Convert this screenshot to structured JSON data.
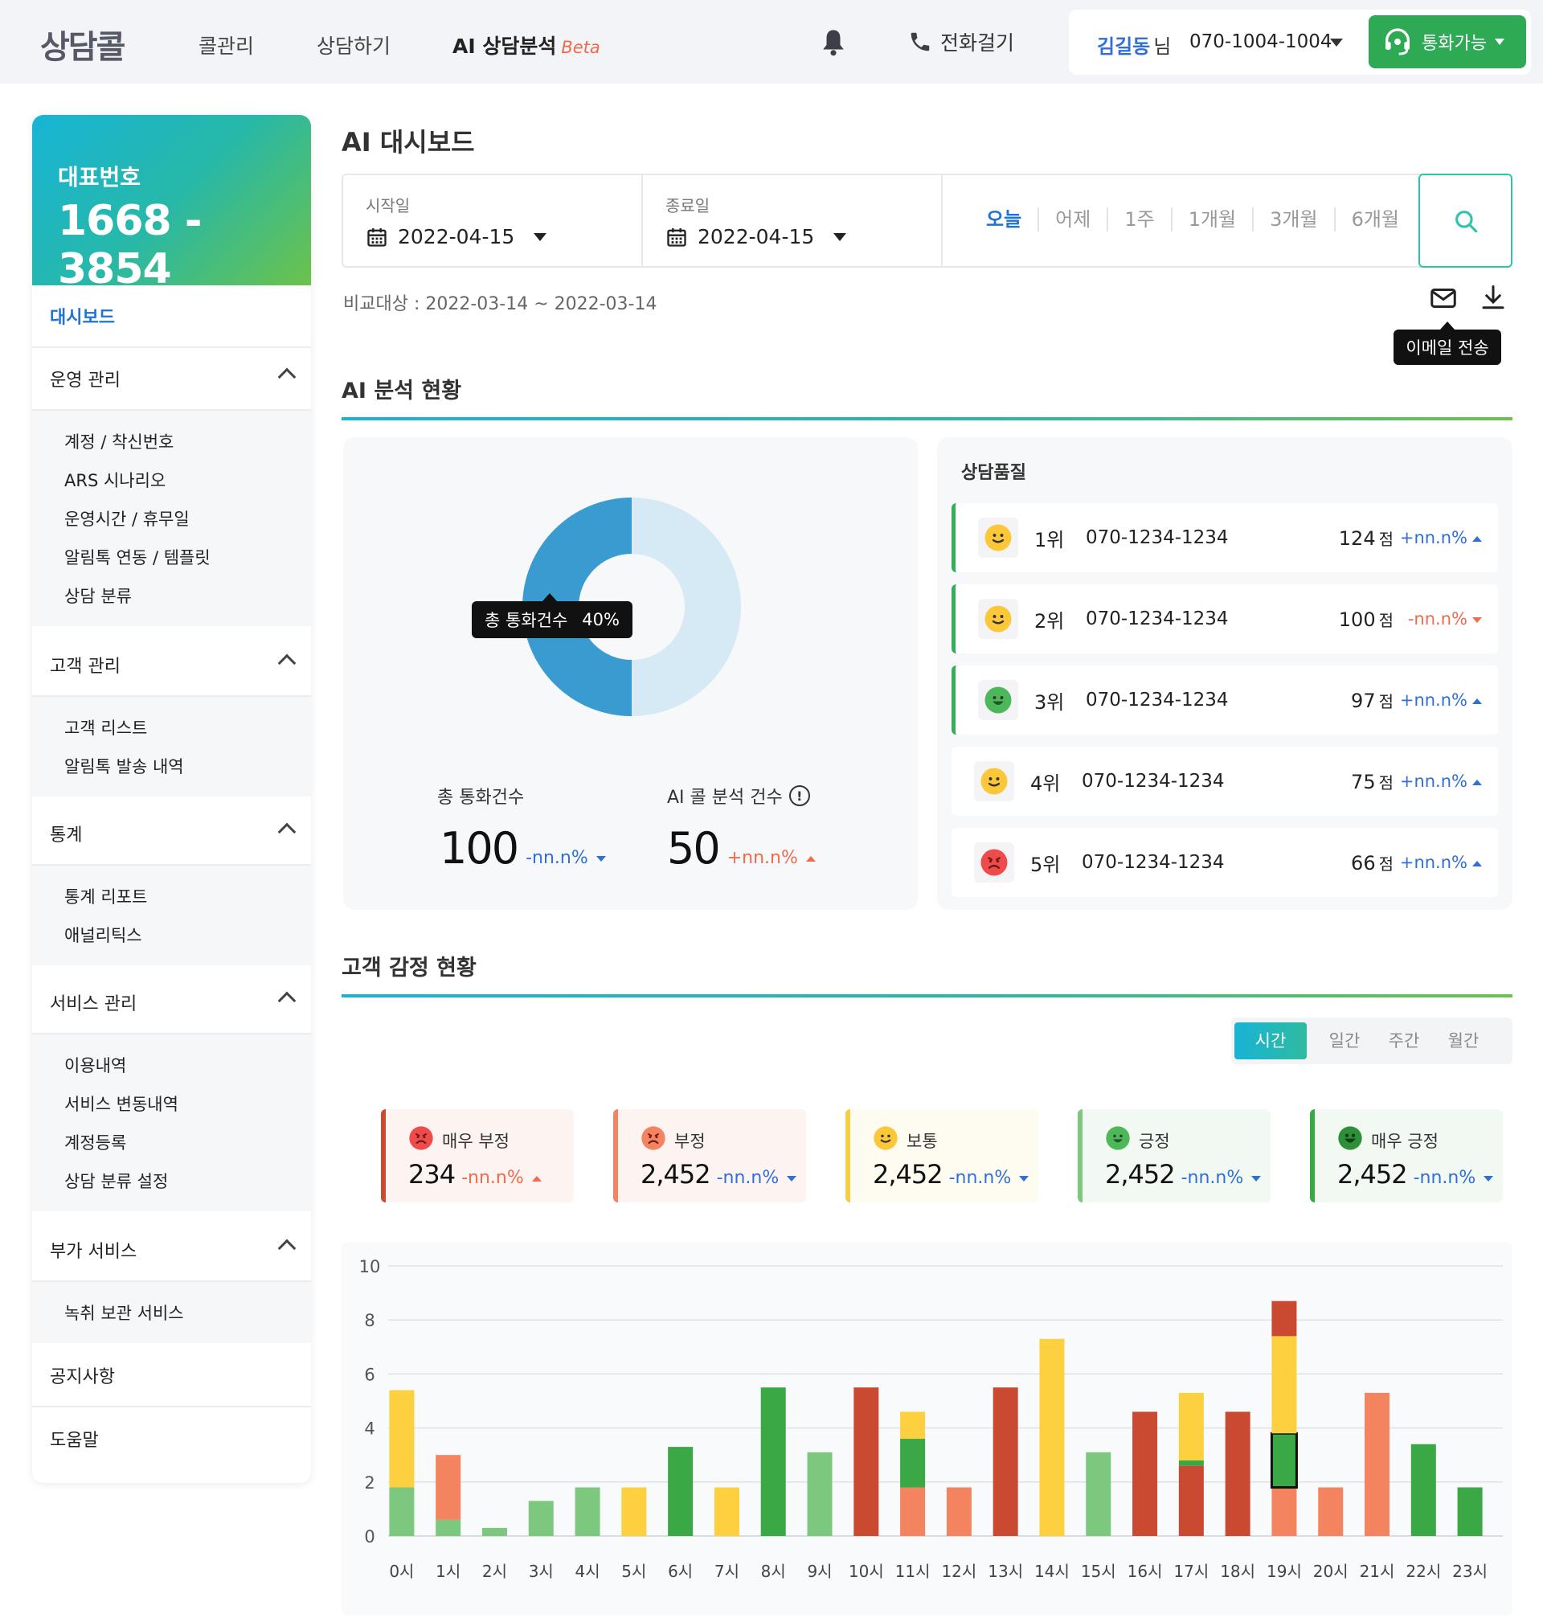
{
  "header": {
    "logo": "상담콜",
    "nav": [
      {
        "label": "콜관리"
      },
      {
        "label": "상담하기"
      },
      {
        "label": "AI 상담분석",
        "badge": "Beta"
      }
    ],
    "call_label": "전화걸기",
    "user_name": "김길동",
    "user_suffix": "님",
    "user_phone": "070-1004-1004",
    "status_label": "통화가능"
  },
  "sidebar": {
    "rep_label": "대표번호",
    "rep_number": "1668 - 3854",
    "dashboard": "대시보드",
    "groups": [
      {
        "title": "운영 관리",
        "items": [
          "계정 / 착신번호",
          "ARS 시나리오",
          "운영시간 / 휴무일",
          "알림톡 연동 / 템플릿",
          "상담 분류"
        ]
      },
      {
        "title": "고객 관리",
        "items": [
          "고객 리스트",
          "알림톡 발송 내역"
        ]
      },
      {
        "title": "통계",
        "items": [
          "통계 리포트",
          "애널리틱스"
        ]
      },
      {
        "title": "서비스 관리",
        "items": [
          "이용내역",
          "서비스 변동내역",
          "계정등록",
          "상담 분류 설정"
        ]
      },
      {
        "title": "부가 서비스",
        "items": [
          "녹취 보관 서비스"
        ]
      }
    ],
    "notice": "공지사항",
    "help": "도움말"
  },
  "main": {
    "title": "AI 대시보드",
    "filter": {
      "start_label": "시작일",
      "start_value": "2022-04-15",
      "end_label": "종료일",
      "end_value": "2022-04-15",
      "periods": [
        "오늘",
        "어제",
        "1주",
        "1개월",
        "3개월",
        "6개월"
      ],
      "active_period": "오늘"
    },
    "compare_text": "비교대상 : 2022-03-14 ~ 2022-03-14",
    "email_tooltip": "이메일 전송",
    "analysis": {
      "title": "AI 분석 현황",
      "donut_tip_label": "총 통화건수",
      "donut_tip_value": "40%",
      "donut_percent": 0.5,
      "total_label": "총 통화건수",
      "total_value": "100",
      "total_delta": "-nn.n%",
      "ai_label": "AI 콜 분석 건수",
      "ai_value": "50",
      "ai_delta": "+nn.n%"
    },
    "ranking": {
      "title": "상담품질",
      "rows": [
        {
          "rank": "1위",
          "phone": "070-1234-1234",
          "score": "124",
          "unit": "점",
          "delta": "+nn.n%",
          "dir": "up",
          "face": "neutral"
        },
        {
          "rank": "2위",
          "phone": "070-1234-1234",
          "score": "100",
          "unit": "점",
          "delta": "-nn.n%",
          "dir": "down",
          "face": "neutral"
        },
        {
          "rank": "3위",
          "phone": "070-1234-1234",
          "score": "97",
          "unit": "점",
          "delta": "+nn.n%",
          "dir": "up",
          "face": "happy"
        },
        {
          "rank": "4위",
          "phone": "070-1234-1234",
          "score": "75",
          "unit": "점",
          "delta": "+nn.n%",
          "dir": "up",
          "face": "neutral"
        },
        {
          "rank": "5위",
          "phone": "070-1234-1234",
          "score": "66",
          "unit": "점",
          "delta": "+nn.n%",
          "dir": "up",
          "face": "angry"
        }
      ]
    },
    "sentiment": {
      "title": "고객 감정 현황",
      "tabs": [
        "시간",
        "일간",
        "주간",
        "월간"
      ],
      "active_tab": "시간",
      "cards": [
        {
          "label": "매우 부정",
          "value": "234",
          "delta": "-nn.n%",
          "dir": "up",
          "color": "#c94a30",
          "bg": "#fdf3f1"
        },
        {
          "label": "부정",
          "value": "2,452",
          "delta": "-nn.n%",
          "dir": "down",
          "color": "#f4845f",
          "bg": "#fdf3f1"
        },
        {
          "label": "보통",
          "value": "2,452",
          "delta": "-nn.n%",
          "dir": "down",
          "color": "#f7cd45",
          "bg": "#fefbf0"
        },
        {
          "label": "긍정",
          "value": "2,452",
          "delta": "-nn.n%",
          "dir": "down",
          "color": "#7cc87f",
          "bg": "#f2f9f2"
        },
        {
          "label": "매우 긍정",
          "value": "2,452",
          "delta": "-nn.n%",
          "dir": "down",
          "color": "#3aa845",
          "bg": "#f2f9f2"
        }
      ]
    }
  },
  "chart_data": {
    "type": "bar",
    "stacked": true,
    "categories": [
      "0시",
      "1시",
      "2시",
      "3시",
      "4시",
      "5시",
      "6시",
      "7시",
      "8시",
      "9시",
      "10시",
      "11시",
      "12시",
      "13시",
      "14시",
      "15시",
      "16시",
      "17시",
      "18시",
      "19시",
      "20시",
      "21시",
      "22시",
      "23시"
    ],
    "ylim": [
      0,
      10
    ],
    "yticks": [
      0,
      2,
      4,
      6,
      8,
      10
    ],
    "grid": true,
    "series": [
      {
        "key": "very_negative",
        "color": "#c94a30",
        "values": [
          0,
          0,
          0,
          0,
          0,
          0,
          0,
          0,
          0,
          0,
          5.5,
          0,
          0,
          5.5,
          0,
          0,
          4.6,
          2.6,
          4.6,
          0,
          0,
          0,
          0,
          0
        ]
      },
      {
        "key": "negative",
        "color": "#f4845f",
        "values": [
          0,
          2.4,
          0,
          0,
          0,
          0,
          0,
          0,
          0,
          0,
          0,
          1.8,
          1.8,
          0,
          0,
          0,
          0,
          0,
          0,
          1.8,
          1.8,
          5.3,
          0,
          0
        ]
      },
      {
        "key": "neutral",
        "color": "#fcd03f",
        "values": [
          3.6,
          0,
          0,
          0,
          0,
          1.8,
          0,
          1.8,
          0,
          0,
          0,
          1.0,
          0,
          0,
          7.3,
          0,
          0,
          2.5,
          0,
          3.6,
          0,
          0,
          0,
          0
        ]
      },
      {
        "key": "positive",
        "color": "#7cc87f",
        "values": [
          1.8,
          0.6,
          0.3,
          1.3,
          1.8,
          0,
          0,
          0,
          0,
          3.1,
          0,
          0,
          0,
          0,
          0,
          3.1,
          0,
          0,
          0,
          0,
          0,
          0,
          0,
          0
        ]
      },
      {
        "key": "very_positive",
        "color": "#3aa845",
        "values": [
          0,
          0,
          0,
          0,
          0,
          0,
          3.3,
          0,
          5.5,
          0,
          0,
          1.8,
          0,
          0,
          0,
          0,
          0,
          0.2,
          0,
          2.0,
          0,
          0,
          3.4,
          1.8
        ]
      }
    ],
    "extra_top": [
      0,
      0,
      0,
      0,
      0,
      0,
      0,
      0,
      0,
      0,
      0,
      0,
      0,
      0,
      0,
      0,
      0,
      0,
      0,
      1.3,
      0,
      0,
      0,
      0
    ],
    "extra_top_color": "#c94a30",
    "stack_order": [
      "positive",
      "negative",
      "very_negative",
      "very_positive",
      "neutral"
    ],
    "highlight_index": 19,
    "highlight_series": "very_positive"
  }
}
